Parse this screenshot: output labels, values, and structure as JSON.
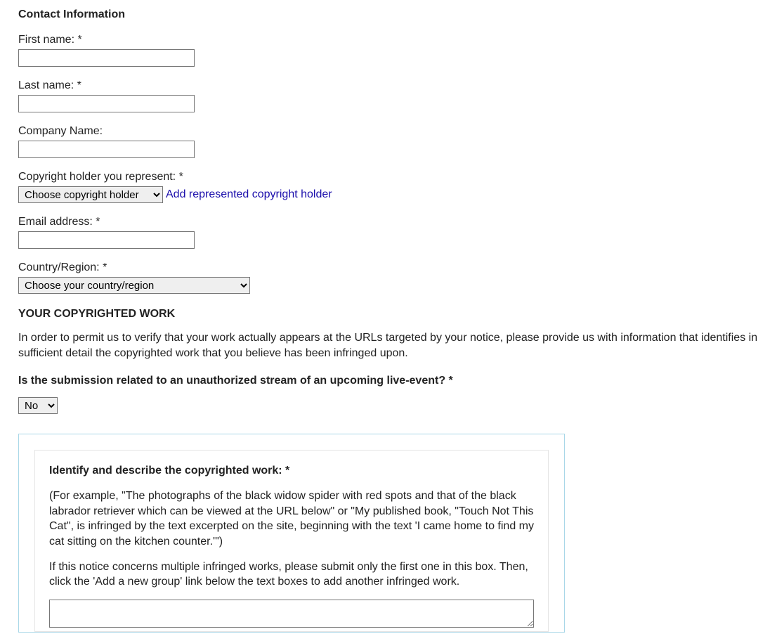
{
  "contact": {
    "heading": "Contact Information",
    "firstNameLabel": "First name: *",
    "firstNameValue": "",
    "lastNameLabel": "Last name: *",
    "lastNameValue": "",
    "companyLabel": "Company Name:",
    "companyValue": "",
    "copyrightHolderLabel": "Copyright holder you represent: *",
    "copyrightHolderSelected": "Choose copyright holder",
    "addCopyrightHolderLink": "Add represented copyright holder",
    "emailLabel": "Email address: *",
    "emailValue": "",
    "countryLabel": "Country/Region: *",
    "countrySelected": "Choose your country/region"
  },
  "work": {
    "heading": "YOUR COPYRIGHTED WORK",
    "intro": "In order to permit us to verify that your work actually appears at the URLs targeted by your notice, please provide us with information that identifies in sufficient detail the copyrighted work that you believe has been infringed upon.",
    "liveEventQuestion": "Is the submission related to an unauthorized stream of an upcoming live-event? *",
    "liveEventSelected": "No",
    "identifyHeading": "Identify and describe the copyrighted work: *",
    "identifyExample": "(For example, \"The photographs of the black widow spider with red spots and that of the black labrador retriever which can be viewed at the URL below\" or \"My published book, \"Touch Not This Cat\", is infringed by the text excerpted on the site, beginning with the text 'I came home to find my cat sitting on the kitchen counter.'\")",
    "identifyMultiple": "If this notice concerns multiple infringed works, please submit only the first one in this box. Then, click the 'Add a new group' link below the text boxes to add another infringed work.",
    "describeValue": ""
  }
}
